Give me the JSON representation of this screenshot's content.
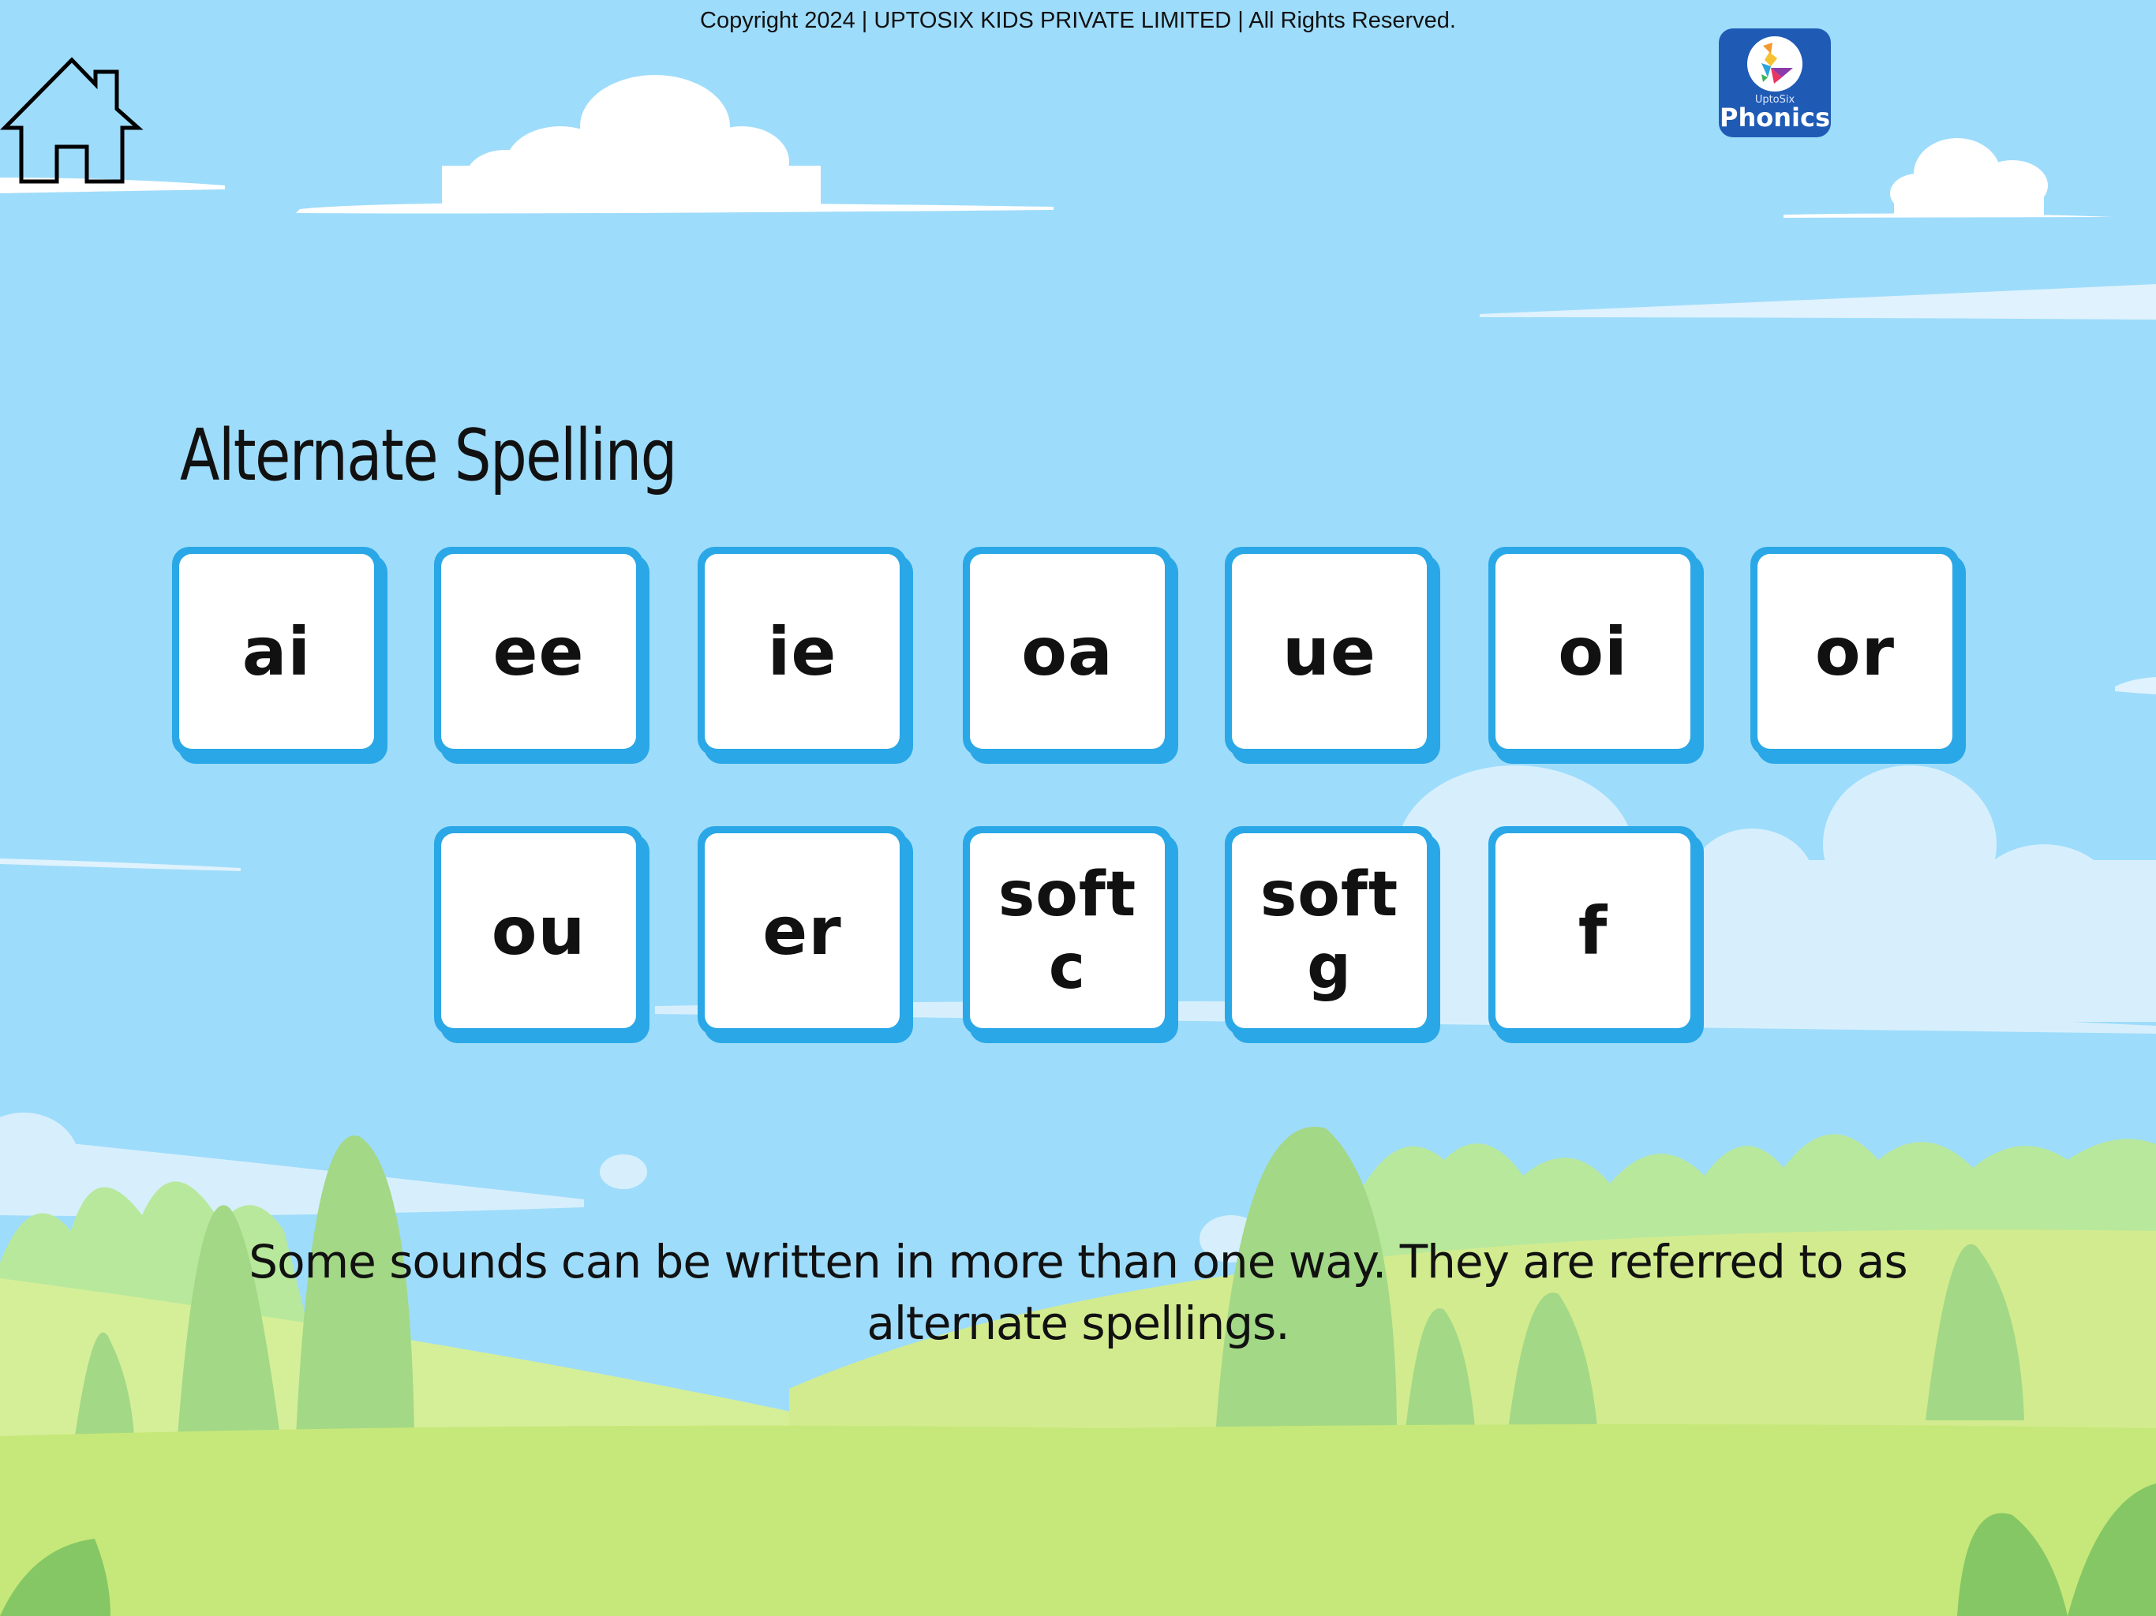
{
  "footer": {
    "copyright": "Copyright 2024 | UPTOSIX KIDS PRIVATE LIMITED | All Rights Reserved."
  },
  "nav": {
    "home_icon": "home-icon"
  },
  "logo": {
    "sub_text": "UptoSix",
    "main_text": "Phonics"
  },
  "page": {
    "title": "Alternate Spelling"
  },
  "cards": [
    {
      "label": "ai"
    },
    {
      "label": "ee"
    },
    {
      "label": "ie"
    },
    {
      "label": "oa"
    },
    {
      "label": "ue"
    },
    {
      "label": "oi"
    },
    {
      "label": "or"
    },
    {
      "label": "ou"
    },
    {
      "label": "er"
    },
    {
      "label": "soft\nc"
    },
    {
      "label": "soft\ng"
    },
    {
      "label": "f"
    }
  ],
  "description": "Some sounds can be written in more than one way. They are referred to as alternate spellings.",
  "colors": {
    "sky": "#9edcfb",
    "card_border": "#2aa7e6",
    "card_face": "#ffffff",
    "logo_bg": "#1f5bb5",
    "grass": "#c6e87a"
  }
}
